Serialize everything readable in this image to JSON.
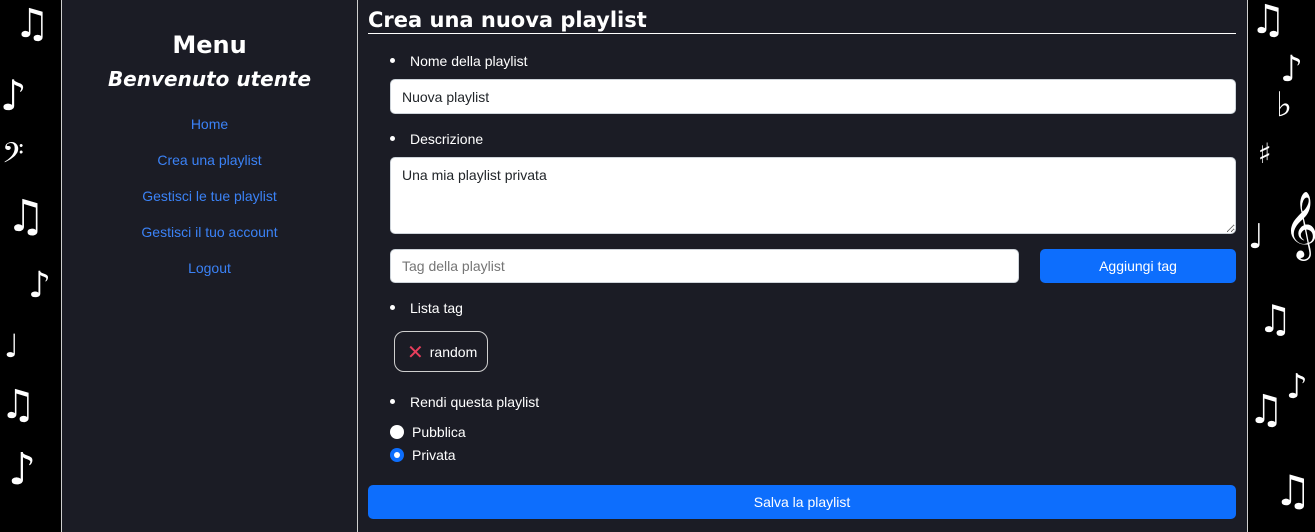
{
  "sidebar": {
    "title": "Menu",
    "welcome": "Benvenuto utente",
    "items": [
      {
        "label": "Home"
      },
      {
        "label": "Crea una playlist"
      },
      {
        "label": "Gestisci le tue playlist"
      },
      {
        "label": "Gestisci il tuo account"
      },
      {
        "label": "Logout"
      }
    ]
  },
  "form": {
    "title": "Crea una nuova playlist",
    "name_label": "Nome della playlist",
    "name_value": "Nuova playlist",
    "description_label": "Descrizione",
    "description_value": "Una mia playlist privata",
    "tag_placeholder": "Tag della playlist",
    "add_tag_button": "Aggiungi tag",
    "tag_list_label": "Lista tag",
    "tags": [
      {
        "label": "random"
      }
    ],
    "visibility_label": "Rendi questa playlist",
    "visibility_options": [
      {
        "label": "Pubblica",
        "checked": false
      },
      {
        "label": "Privata",
        "checked": true
      }
    ],
    "save_button": "Salva la playlist"
  },
  "colors": {
    "accent": "#0d6efd",
    "link": "#3b82f6",
    "panel_bg": "#1b1c25",
    "remove_tag": "#e83e5c"
  },
  "icons": {
    "remove_tag": "close-icon",
    "background": "music-note-icon"
  }
}
